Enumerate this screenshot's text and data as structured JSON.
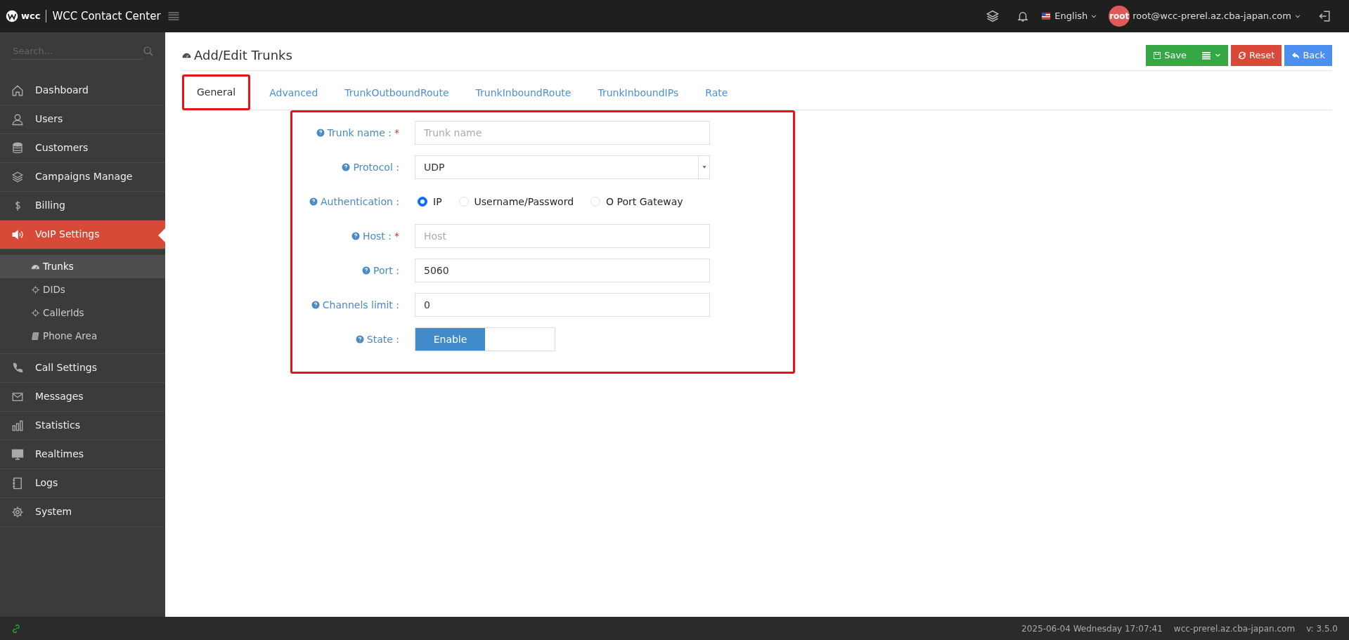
{
  "topbar": {
    "logo": "wcc",
    "title": "WCC Contact Center",
    "language": "English",
    "avatar": "root",
    "user": "root@wcc-prerel.az.cba-japan.com"
  },
  "sidebar": {
    "search": {
      "placeholder": "Search..."
    },
    "items": [
      {
        "label": "Dashboard",
        "selected": false
      },
      {
        "label": "Users",
        "selected": false
      },
      {
        "label": "Customers",
        "selected": false
      },
      {
        "label": "Campaigns Manage",
        "selected": false
      },
      {
        "label": "Billing",
        "selected": false
      },
      {
        "label": "VoIP Settings",
        "selected": true,
        "children": [
          {
            "label": "Trunks",
            "selected": true
          },
          {
            "label": "DIDs",
            "selected": false
          },
          {
            "label": "CallerIds",
            "selected": false
          },
          {
            "label": "Phone Area",
            "selected": false
          }
        ]
      },
      {
        "label": "Call Settings",
        "selected": false
      },
      {
        "label": "Messages",
        "selected": false
      },
      {
        "label": "Statistics",
        "selected": false
      },
      {
        "label": "Realtimes",
        "selected": false
      },
      {
        "label": "Logs",
        "selected": false
      },
      {
        "label": "System",
        "selected": false
      }
    ]
  },
  "page": {
    "title": "Add/Edit Trunks",
    "buttons": [
      {
        "kind": "save",
        "label": "Save"
      },
      {
        "kind": "menu"
      },
      {
        "kind": "reset",
        "label": "Reset"
      },
      {
        "kind": "back",
        "label": "Back"
      }
    ],
    "tabs": [
      {
        "label": "General",
        "selected": true
      },
      {
        "label": "Advanced",
        "selected": false
      },
      {
        "label": "TrunkOutboundRoute",
        "selected": false
      },
      {
        "label": "TrunkInboundRoute",
        "selected": false
      },
      {
        "label": "TrunkInboundIPs",
        "selected": false
      },
      {
        "label": "Rate",
        "selected": false
      }
    ],
    "fields": [
      {
        "kind": "text",
        "label": "Trunk name :",
        "required_mark": "*",
        "placeholder": "Trunk name"
      },
      {
        "kind": "select",
        "label": "Protocol :",
        "value": "UDP"
      },
      {
        "kind": "radio",
        "label": "Authentication :",
        "options": [
          {
            "label": "IP",
            "selected": true
          },
          {
            "label": "Username/Password",
            "selected": false
          },
          {
            "label": "O Port Gateway",
            "selected": false
          }
        ]
      },
      {
        "kind": "text",
        "label": "Host :",
        "required_mark": "*",
        "placeholder": "Host"
      },
      {
        "kind": "text",
        "label": "Port :",
        "value": "5060"
      },
      {
        "kind": "text",
        "label": "Channels limit :",
        "value": "0"
      },
      {
        "kind": "toggle",
        "label": "State :",
        "on": true,
        "text": "Enable"
      }
    ]
  },
  "footer": {
    "datetime": "2025-06-04 Wednesday 17:07:41",
    "host": "wcc-prerel.az.cba-japan.com",
    "version": "v: 3.5.0"
  }
}
